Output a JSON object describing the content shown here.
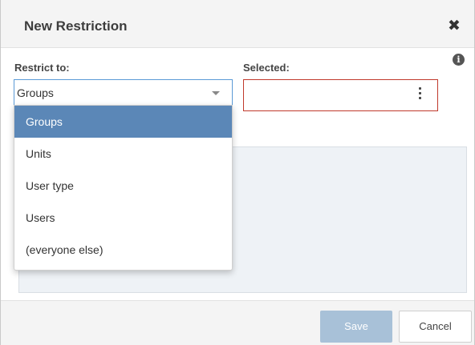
{
  "dialog": {
    "title": "New Restriction",
    "close_icon": "close-icon"
  },
  "restrict_to": {
    "label": "Restrict to:",
    "selected_value": "Groups",
    "options": [
      "Groups",
      "Units",
      "User type",
      "Users",
      "(everyone else)"
    ],
    "active_index": 0
  },
  "selected": {
    "label": "Selected:",
    "menu_icon": "kebab-menu-icon"
  },
  "info_icon": "info-icon",
  "footer": {
    "save_label": "Save",
    "cancel_label": "Cancel"
  },
  "colors": {
    "accent": "#5b87b7",
    "focus_border": "#5b9ad6",
    "error_border": "#c0392b",
    "save_disabled": "#a8c1d8"
  }
}
